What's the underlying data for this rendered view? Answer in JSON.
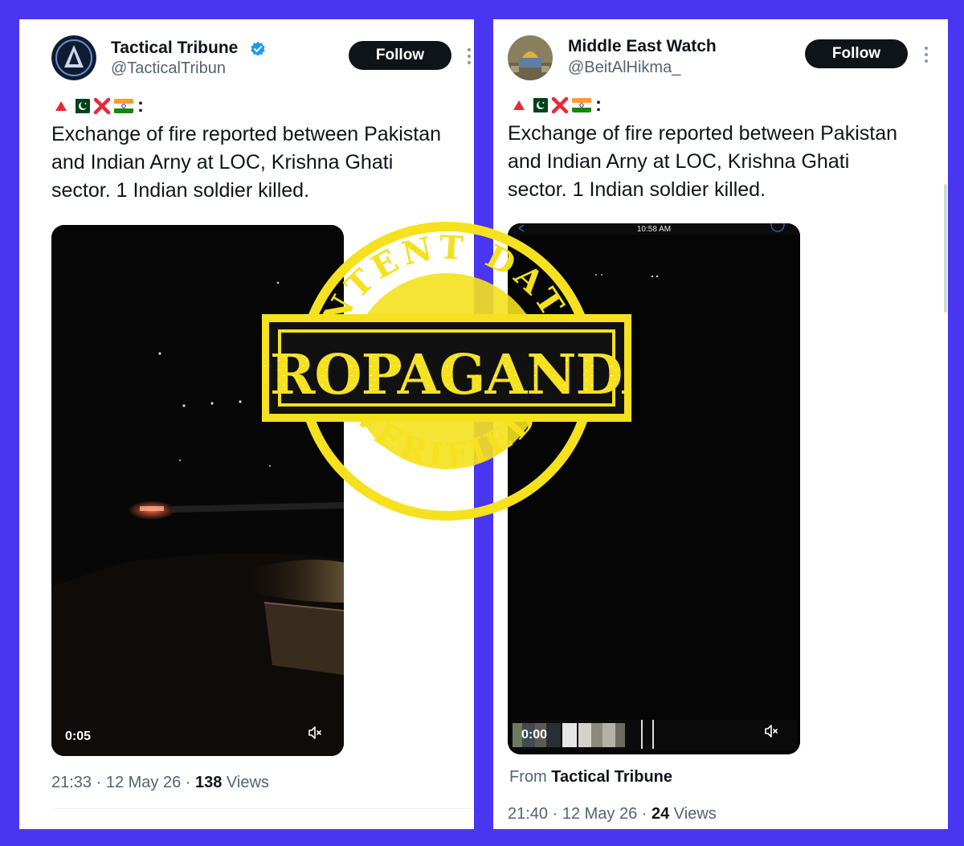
{
  "left_tweet": {
    "display_name": "Tactical Tribune",
    "handle": "@TacticalTribun",
    "verified": true,
    "follow_label": "Follow",
    "emoji_line": [
      "red-triangle",
      "pakistan-flag",
      "red-cross",
      "india-flag",
      ":"
    ],
    "text": "Exchange of fire reported between Pakistan\nand Indian Arny at LOC, Krishna Ghati\nsector. 1 Indian soldier killed.",
    "video": {
      "timecode": "0:05",
      "mute_icon": "muted-speaker-icon"
    },
    "timestamp": "21:33 · 12 May 26 · ",
    "views_count": "138",
    "views_label": " Views"
  },
  "right_tweet": {
    "display_name": "Middle East Watch",
    "handle": "@BeitAlHikma_",
    "verified": false,
    "follow_label": "Follow",
    "emoji_line": [
      "red-triangle",
      "pakistan-flag",
      "red-cross",
      "india-flag",
      ":"
    ],
    "text": "Exchange of fire reported between Pakistan\nand Indian Arny at LOC, Krishna Ghati\nsector. 1 Indian soldier killed.",
    "video": {
      "status_time": "10:58 AM",
      "timecode": "0:00",
      "mute_icon": "muted-speaker-icon"
    },
    "source_prefix": "From ",
    "source_name": "Tactical Tribune",
    "timestamp": "21:40 · 12 May 26 · ",
    "views_count": "24",
    "views_label": " Views"
  },
  "stamp": {
    "top_arc": "INTENT DATA",
    "main_word": "PROPAGANDA",
    "bottom_arc": "VERIFIED",
    "color": "#f5e11e"
  },
  "colors": {
    "frame": "#4a35f0",
    "follow_bg": "#0f1419",
    "verified": "#1d9bf0",
    "muted_text": "#536471"
  }
}
